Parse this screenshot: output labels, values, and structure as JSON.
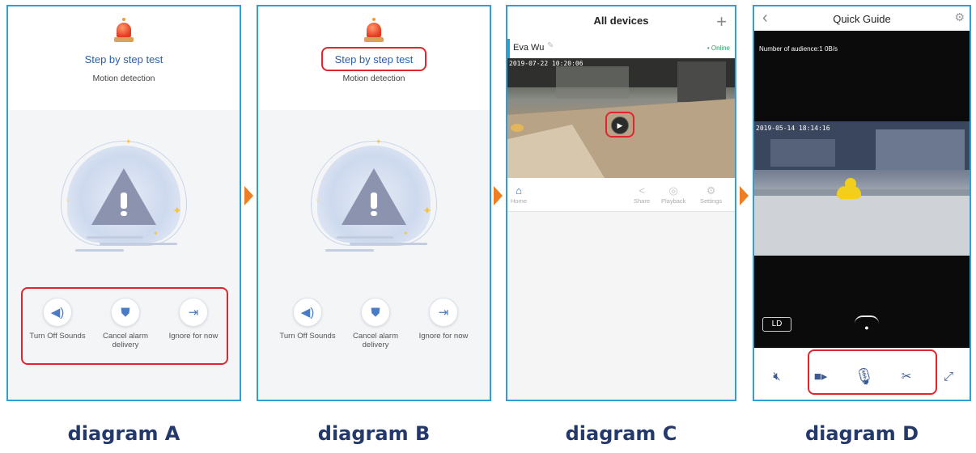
{
  "panels": {
    "a": {
      "title": "Step by step test",
      "subtitle": "Motion detection",
      "actions": [
        {
          "label": "Turn Off Sounds",
          "icon": "speaker-icon"
        },
        {
          "label": "Cancel alarm delivery",
          "icon": "shield-icon"
        },
        {
          "label": "Ignore for now",
          "icon": "exit-icon"
        }
      ],
      "caption": "diagram A"
    },
    "b": {
      "title": "Step by step test",
      "subtitle": "Motion detection",
      "actions": [
        {
          "label": "Turn Off Sounds",
          "icon": "speaker-icon"
        },
        {
          "label": "Cancel alarm delivery",
          "icon": "shield-icon"
        },
        {
          "label": "Ignore for now",
          "icon": "exit-icon"
        }
      ],
      "caption": "diagram B"
    },
    "c": {
      "title": "All devices",
      "device_name": "Eva Wu",
      "status": "• Online",
      "timestamp": "2019-07-22 10:20:06",
      "nav": [
        "Home",
        "Share",
        "Playback",
        "Settings"
      ],
      "caption": "diagram C"
    },
    "d": {
      "title": "Quick Guide",
      "audience": "Number of audience:1   0B/s",
      "timestamp": "2019-05-14 18:14:16",
      "quality": "LD",
      "caption": "diagram D"
    }
  },
  "colors": {
    "panel_border": "#2ea0d8",
    "highlight": "#e1252e",
    "arrow": "#ef7d22",
    "caption": "#24396b",
    "title_blue": "#2b5fa8",
    "online_green": "#25a36a"
  }
}
